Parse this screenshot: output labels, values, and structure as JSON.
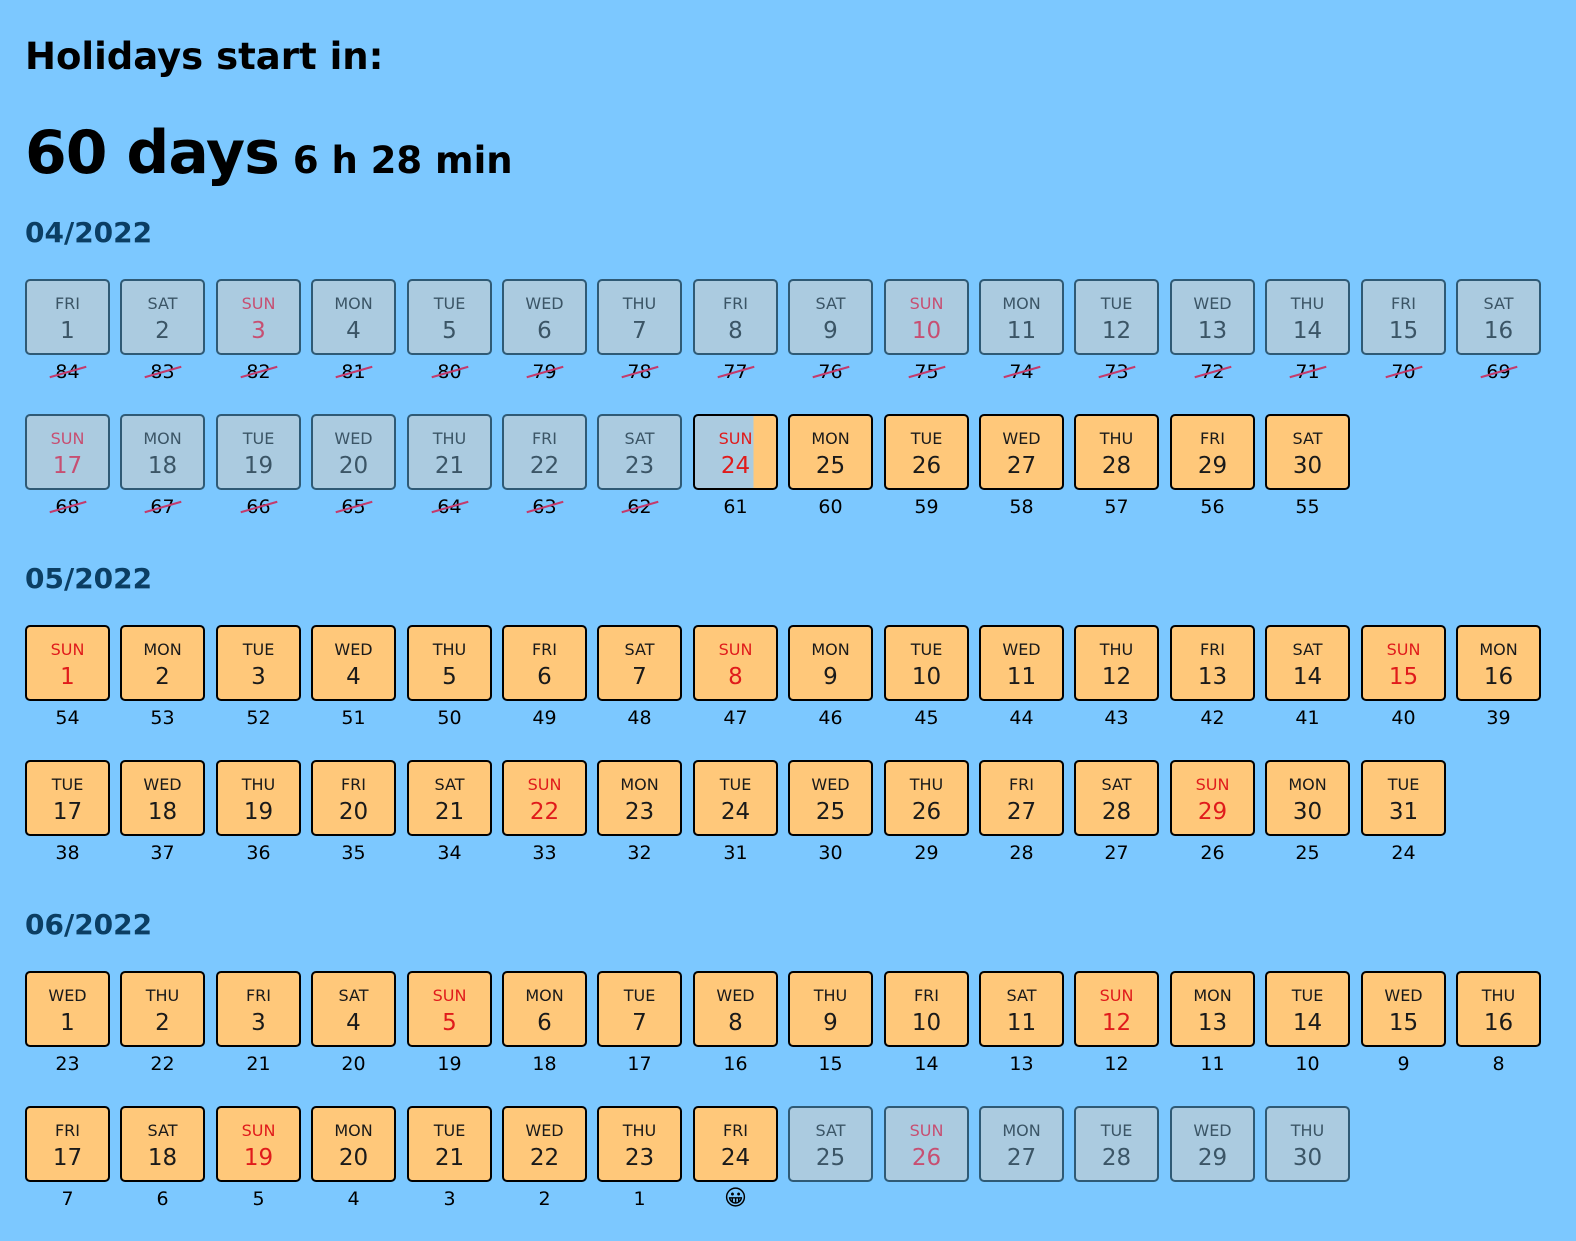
{
  "headline": "Holidays start in:",
  "countdown": {
    "days": "60 days",
    "rest": "6 h 28 min"
  },
  "colors": {
    "background": "#7cc8ff",
    "future": "#ffc87a",
    "past": "#abcbe0",
    "sunday": "#e01b1b"
  },
  "months": [
    {
      "title": "04/2022",
      "days": [
        {
          "dow": "FRI",
          "num": "1",
          "count": "84",
          "state": "past"
        },
        {
          "dow": "SAT",
          "num": "2",
          "count": "83",
          "state": "past"
        },
        {
          "dow": "SUN",
          "num": "3",
          "count": "82",
          "state": "past"
        },
        {
          "dow": "MON",
          "num": "4",
          "count": "81",
          "state": "past"
        },
        {
          "dow": "TUE",
          "num": "5",
          "count": "80",
          "state": "past"
        },
        {
          "dow": "WED",
          "num": "6",
          "count": "79",
          "state": "past"
        },
        {
          "dow": "THU",
          "num": "7",
          "count": "78",
          "state": "past"
        },
        {
          "dow": "FRI",
          "num": "8",
          "count": "77",
          "state": "past"
        },
        {
          "dow": "SAT",
          "num": "9",
          "count": "76",
          "state": "past"
        },
        {
          "dow": "SUN",
          "num": "10",
          "count": "75",
          "state": "past"
        },
        {
          "dow": "MON",
          "num": "11",
          "count": "74",
          "state": "past"
        },
        {
          "dow": "TUE",
          "num": "12",
          "count": "73",
          "state": "past"
        },
        {
          "dow": "WED",
          "num": "13",
          "count": "72",
          "state": "past"
        },
        {
          "dow": "THU",
          "num": "14",
          "count": "71",
          "state": "past"
        },
        {
          "dow": "FRI",
          "num": "15",
          "count": "70",
          "state": "past"
        },
        {
          "dow": "SAT",
          "num": "16",
          "count": "69",
          "state": "past"
        },
        {
          "dow": "SUN",
          "num": "17",
          "count": "68",
          "state": "past"
        },
        {
          "dow": "MON",
          "num": "18",
          "count": "67",
          "state": "past"
        },
        {
          "dow": "TUE",
          "num": "19",
          "count": "66",
          "state": "past"
        },
        {
          "dow": "WED",
          "num": "20",
          "count": "65",
          "state": "past"
        },
        {
          "dow": "THU",
          "num": "21",
          "count": "64",
          "state": "past"
        },
        {
          "dow": "FRI",
          "num": "22",
          "count": "63",
          "state": "past"
        },
        {
          "dow": "SAT",
          "num": "23",
          "count": "62",
          "state": "past"
        },
        {
          "dow": "SUN",
          "num": "24",
          "count": "61",
          "state": "partial"
        },
        {
          "dow": "MON",
          "num": "25",
          "count": "60",
          "state": "future"
        },
        {
          "dow": "TUE",
          "num": "26",
          "count": "59",
          "state": "future"
        },
        {
          "dow": "WED",
          "num": "27",
          "count": "58",
          "state": "future"
        },
        {
          "dow": "THU",
          "num": "28",
          "count": "57",
          "state": "future"
        },
        {
          "dow": "FRI",
          "num": "29",
          "count": "56",
          "state": "future"
        },
        {
          "dow": "SAT",
          "num": "30",
          "count": "55",
          "state": "future"
        }
      ]
    },
    {
      "title": "05/2022",
      "days": [
        {
          "dow": "SUN",
          "num": "1",
          "count": "54",
          "state": "future"
        },
        {
          "dow": "MON",
          "num": "2",
          "count": "53",
          "state": "future"
        },
        {
          "dow": "TUE",
          "num": "3",
          "count": "52",
          "state": "future"
        },
        {
          "dow": "WED",
          "num": "4",
          "count": "51",
          "state": "future"
        },
        {
          "dow": "THU",
          "num": "5",
          "count": "50",
          "state": "future"
        },
        {
          "dow": "FRI",
          "num": "6",
          "count": "49",
          "state": "future"
        },
        {
          "dow": "SAT",
          "num": "7",
          "count": "48",
          "state": "future"
        },
        {
          "dow": "SUN",
          "num": "8",
          "count": "47",
          "state": "future"
        },
        {
          "dow": "MON",
          "num": "9",
          "count": "46",
          "state": "future"
        },
        {
          "dow": "TUE",
          "num": "10",
          "count": "45",
          "state": "future"
        },
        {
          "dow": "WED",
          "num": "11",
          "count": "44",
          "state": "future"
        },
        {
          "dow": "THU",
          "num": "12",
          "count": "43",
          "state": "future"
        },
        {
          "dow": "FRI",
          "num": "13",
          "count": "42",
          "state": "future"
        },
        {
          "dow": "SAT",
          "num": "14",
          "count": "41",
          "state": "future"
        },
        {
          "dow": "SUN",
          "num": "15",
          "count": "40",
          "state": "future"
        },
        {
          "dow": "MON",
          "num": "16",
          "count": "39",
          "state": "future"
        },
        {
          "dow": "TUE",
          "num": "17",
          "count": "38",
          "state": "future"
        },
        {
          "dow": "WED",
          "num": "18",
          "count": "37",
          "state": "future"
        },
        {
          "dow": "THU",
          "num": "19",
          "count": "36",
          "state": "future"
        },
        {
          "dow": "FRI",
          "num": "20",
          "count": "35",
          "state": "future"
        },
        {
          "dow": "SAT",
          "num": "21",
          "count": "34",
          "state": "future"
        },
        {
          "dow": "SUN",
          "num": "22",
          "count": "33",
          "state": "future"
        },
        {
          "dow": "MON",
          "num": "23",
          "count": "32",
          "state": "future"
        },
        {
          "dow": "TUE",
          "num": "24",
          "count": "31",
          "state": "future"
        },
        {
          "dow": "WED",
          "num": "25",
          "count": "30",
          "state": "future"
        },
        {
          "dow": "THU",
          "num": "26",
          "count": "29",
          "state": "future"
        },
        {
          "dow": "FRI",
          "num": "27",
          "count": "28",
          "state": "future"
        },
        {
          "dow": "SAT",
          "num": "28",
          "count": "27",
          "state": "future"
        },
        {
          "dow": "SUN",
          "num": "29",
          "count": "26",
          "state": "future"
        },
        {
          "dow": "MON",
          "num": "30",
          "count": "25",
          "state": "future"
        },
        {
          "dow": "TUE",
          "num": "31",
          "count": "24",
          "state": "future"
        }
      ]
    },
    {
      "title": "06/2022",
      "days": [
        {
          "dow": "WED",
          "num": "1",
          "count": "23",
          "state": "future"
        },
        {
          "dow": "THU",
          "num": "2",
          "count": "22",
          "state": "future"
        },
        {
          "dow": "FRI",
          "num": "3",
          "count": "21",
          "state": "future"
        },
        {
          "dow": "SAT",
          "num": "4",
          "count": "20",
          "state": "future"
        },
        {
          "dow": "SUN",
          "num": "5",
          "count": "19",
          "state": "future"
        },
        {
          "dow": "MON",
          "num": "6",
          "count": "18",
          "state": "future"
        },
        {
          "dow": "TUE",
          "num": "7",
          "count": "17",
          "state": "future"
        },
        {
          "dow": "WED",
          "num": "8",
          "count": "16",
          "state": "future"
        },
        {
          "dow": "THU",
          "num": "9",
          "count": "15",
          "state": "future"
        },
        {
          "dow": "FRI",
          "num": "10",
          "count": "14",
          "state": "future"
        },
        {
          "dow": "SAT",
          "num": "11",
          "count": "13",
          "state": "future"
        },
        {
          "dow": "SUN",
          "num": "12",
          "count": "12",
          "state": "future"
        },
        {
          "dow": "MON",
          "num": "13",
          "count": "11",
          "state": "future"
        },
        {
          "dow": "TUE",
          "num": "14",
          "count": "10",
          "state": "future"
        },
        {
          "dow": "WED",
          "num": "15",
          "count": "9",
          "state": "future"
        },
        {
          "dow": "THU",
          "num": "16",
          "count": "8",
          "state": "future"
        },
        {
          "dow": "FRI",
          "num": "17",
          "count": "7",
          "state": "future"
        },
        {
          "dow": "SAT",
          "num": "18",
          "count": "6",
          "state": "future"
        },
        {
          "dow": "SUN",
          "num": "19",
          "count": "5",
          "state": "future"
        },
        {
          "dow": "MON",
          "num": "20",
          "count": "4",
          "state": "future"
        },
        {
          "dow": "TUE",
          "num": "21",
          "count": "3",
          "state": "future"
        },
        {
          "dow": "WED",
          "num": "22",
          "count": "2",
          "state": "future"
        },
        {
          "dow": "THU",
          "num": "23",
          "count": "1",
          "state": "future"
        },
        {
          "dow": "FRI",
          "num": "24",
          "count": "😀",
          "state": "future",
          "icon": "smiley-icon"
        },
        {
          "dow": "SAT",
          "num": "25",
          "count": "",
          "state": "past"
        },
        {
          "dow": "SUN",
          "num": "26",
          "count": "",
          "state": "past"
        },
        {
          "dow": "MON",
          "num": "27",
          "count": "",
          "state": "past"
        },
        {
          "dow": "TUE",
          "num": "28",
          "count": "",
          "state": "past"
        },
        {
          "dow": "WED",
          "num": "29",
          "count": "",
          "state": "past"
        },
        {
          "dow": "THU",
          "num": "30",
          "count": "",
          "state": "past"
        }
      ]
    }
  ]
}
